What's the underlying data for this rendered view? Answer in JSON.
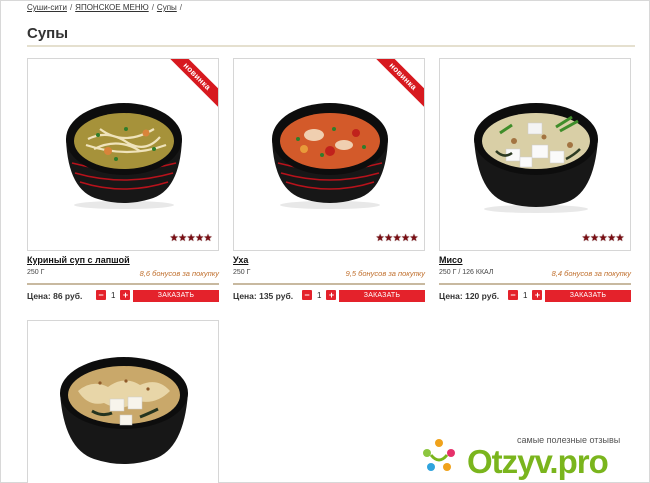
{
  "breadcrumb": [
    {
      "label": "Суши-сити"
    },
    {
      "label": "ЯПОНСКОЕ МЕНЮ"
    },
    {
      "label": "Супы"
    }
  ],
  "breadcrumb_sep": "/",
  "page_title": "Супы",
  "badge_new": "новинка",
  "stars": "★★★★★",
  "price_prefix": "Цена:",
  "order_label": "ЗАКАЗАТЬ",
  "products": [
    {
      "name": "Куриный суп с лапшой",
      "weight": "250 Г",
      "bonus": "8,6 бонусов за покупку",
      "price": "Цена: 86 руб.",
      "qty": "1",
      "is_new": true,
      "rating": 5
    },
    {
      "name": "Уха",
      "weight": "250 Г",
      "bonus": "9,5 бонусов за покупку",
      "price": "Цена: 135 руб.",
      "qty": "1",
      "is_new": true,
      "rating": 5
    },
    {
      "name": "Мисо",
      "weight": "250 Г / 126 ККАЛ",
      "bonus": "8,4 бонусов за покупку",
      "price": "Цена: 120 руб.",
      "qty": "1",
      "is_new": false,
      "rating": 5
    }
  ],
  "qty_minus": "−",
  "qty_plus": "+",
  "watermark": {
    "tagline": "самые полезные отзывы",
    "brand": "Otzyv.pro"
  },
  "colors": {
    "accent": "#e4222b",
    "bonus": "#c0702e",
    "rule": "#c8b9a0",
    "brand_green": "#7ab51d"
  }
}
